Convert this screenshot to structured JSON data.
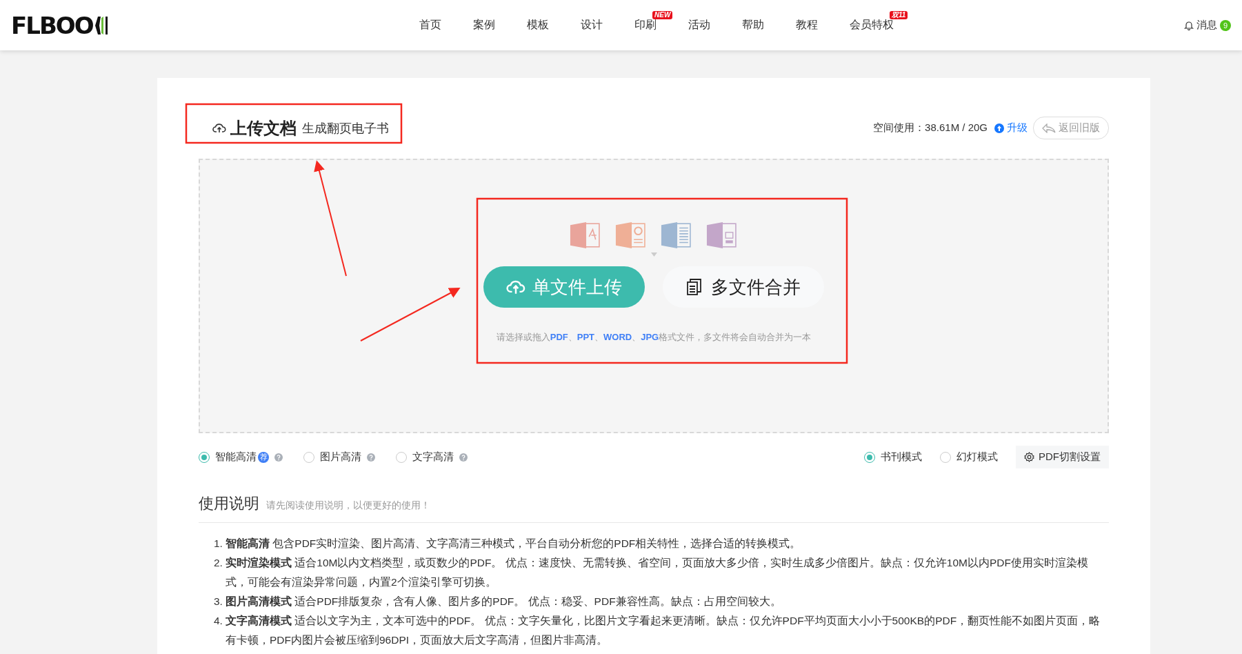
{
  "header": {
    "logo": "FLBOO",
    "nav": [
      {
        "label": "首页"
      },
      {
        "label": "案例"
      },
      {
        "label": "模板"
      },
      {
        "label": "设计"
      },
      {
        "label": "印刷",
        "badge": "NEW"
      },
      {
        "label": "活动"
      },
      {
        "label": "帮助"
      },
      {
        "label": "教程"
      },
      {
        "label": "会员特权",
        "badge": "双11"
      }
    ],
    "messages": {
      "label": "消息",
      "count": "9"
    }
  },
  "upload": {
    "title": "上传文档",
    "subtitle": "生成翻页电子书",
    "space_label": "空间使用：38.61M / 20G",
    "upgrade": "升级",
    "back_button": "返回旧版",
    "file_types": [
      {
        "kind": "pdf",
        "color": "#e9a49b"
      },
      {
        "kind": "ppt",
        "color": "#efaf96"
      },
      {
        "kind": "word",
        "color": "#9db6d2"
      },
      {
        "kind": "jpg",
        "color": "#c3a6c9"
      }
    ],
    "single_button": "单文件上传",
    "merge_button": "多文件合并",
    "hint": [
      {
        "kind": "plain",
        "text": "请选择或拖入"
      },
      {
        "kind": "format",
        "text": "PDF"
      },
      {
        "kind": "plain",
        "text": "、"
      },
      {
        "kind": "format",
        "text": "PPT"
      },
      {
        "kind": "plain",
        "text": "、"
      },
      {
        "kind": "format",
        "text": "WORD"
      },
      {
        "kind": "plain",
        "text": "、"
      },
      {
        "kind": "format",
        "text": "JPG"
      },
      {
        "kind": "plain",
        "text": "格式文件，多文件将会自动合并为一本"
      }
    ]
  },
  "quality_options": [
    {
      "label": "智能高清",
      "badge": "荐",
      "selected": true
    },
    {
      "label": "图片高清",
      "selected": false
    },
    {
      "label": "文字高清",
      "selected": false
    }
  ],
  "mode_options": [
    {
      "label": "书刊模式",
      "selected": true
    },
    {
      "label": "幻灯模式",
      "selected": false
    }
  ],
  "pdf_settings_button": "PDF切割设置",
  "instructions": {
    "title": "使用说明",
    "subtitle": "请先阅读使用说明，以便更好的使用！",
    "items": [
      {
        "number": "1.",
        "term": "智能高清",
        "text": "包含PDF实时渲染、图片高清、文字高清三种模式，平台自动分析您的PDF相关特性，选择合适的转换模式。"
      },
      {
        "number": "2.",
        "term": "实时渲染模式",
        "text": "适合10M以内文档类型，或页数少的PDF。 优点：速度快、无需转换、省空间，页面放大多少倍，实时生成多少倍图片。缺点：仅允许10M以内PDF使用实时渲染模式，可能会有渲染异常问题，内置2个渲染引擎可切换。"
      },
      {
        "number": "3.",
        "term": "图片高清模式",
        "text": "适合PDF排版复杂，含有人像、图片多的PDF。 优点：稳妥、PDF兼容性高。缺点：占用空间较大。"
      },
      {
        "number": "4.",
        "term": "文字高清模式",
        "text": "适合以文字为主，文本可选中的PDF。 优点：文字矢量化，比图片文字看起来更清晰。缺点：仅允许PDF平均页面大小小于500KB的PDF，翻页性能不如图片页面，略有卡顿，PDF内图片会被压缩到96DPI，页面放大后文字高清，但图片非高清。"
      }
    ]
  }
}
